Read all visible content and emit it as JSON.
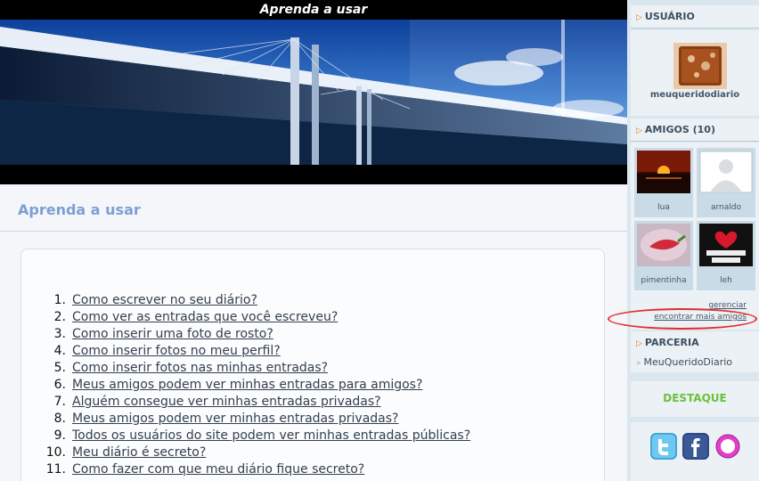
{
  "header": {
    "title": "Aprenda a usar"
  },
  "main": {
    "heading": "Aprenda a usar",
    "faq": [
      {
        "num": "1.",
        "text": "Como escrever no seu diário?"
      },
      {
        "num": "2.",
        "text": "Como ver as entradas que você escreveu?"
      },
      {
        "num": "3.",
        "text": "Como inserir uma foto de rosto?"
      },
      {
        "num": "4.",
        "text": "Como inserir fotos no meu perfil?"
      },
      {
        "num": "5.",
        "text": "Como inserir fotos nas minhas entradas?"
      },
      {
        "num": "6.",
        "text": "Meus amigos podem ver minhas entradas para amigos?"
      },
      {
        "num": "7.",
        "text": "Alguém consegue ver minhas entradas privadas?"
      },
      {
        "num": "8.",
        "text": "Meus amigos podem ver minhas entradas privadas?"
      },
      {
        "num": "9.",
        "text": "Todos os usuários do site podem ver minhas entradas públicas?"
      },
      {
        "num": "10.",
        "text": "Meu diário é secreto?"
      },
      {
        "num": "11.",
        "text": "Como fazer com que meu diário fique secreto?"
      }
    ]
  },
  "sidebar": {
    "user_title": "USUÁRIO",
    "user_name": "meuqueridodiario",
    "friends_title": "AMIGOS (10)",
    "friends": [
      {
        "name": "lua"
      },
      {
        "name": "arnaldo"
      },
      {
        "name": "pimentinha"
      },
      {
        "name": "leh"
      }
    ],
    "manage_label": "gerenciar",
    "find_friends_label": "encontrar mais amigos",
    "partner_title": "PARCERIA",
    "partner_item": "MeuQueridoDiario",
    "highlight_title": "DESTAQUE"
  },
  "colors": {
    "accent_blue": "#7d9fd6",
    "sidebar_bg": "#dbe7ee",
    "highlight_green": "#6cc03a",
    "annotation_red": "#e42c2c"
  },
  "icons": [
    "twitter-icon",
    "facebook-icon",
    "orkut-icon"
  ]
}
